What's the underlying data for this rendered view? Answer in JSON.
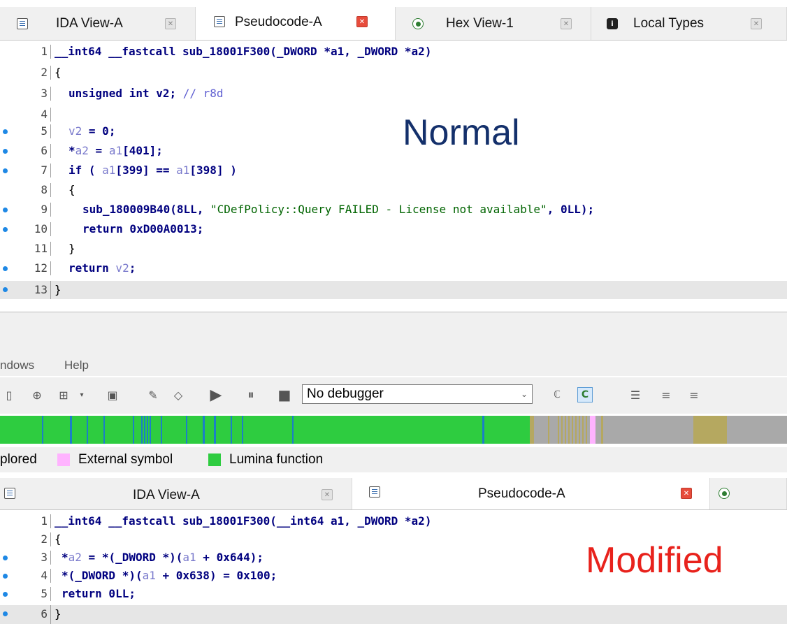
{
  "top_tabs": [
    {
      "label": "IDA View-A",
      "icon": "list-icon",
      "active": false
    },
    {
      "label": "Pseudocode-A",
      "icon": "list-icon",
      "active": true
    },
    {
      "label": "Hex View-1",
      "icon": "hex-icon",
      "active": false
    },
    {
      "label": "Local Types",
      "icon": "info-icon",
      "active": false
    }
  ],
  "normal_label": "Normal",
  "normal_code": {
    "line_numbers": [
      "1",
      "2",
      "3",
      "4",
      "5",
      "6",
      "7",
      "8",
      "9",
      "10",
      "11",
      "12",
      "13"
    ],
    "l1": {
      "t1": "__int64 __fastcall sub_18001F300(",
      "t2": "_DWORD *a1, _DWORD *a2)"
    },
    "l2": {
      "t1": "{"
    },
    "l3": {
      "kw": "unsigned int",
      "t1": " v2; ",
      "cm": "// r8d"
    },
    "l5": {
      "var": "v2",
      "op": " = ",
      "num": "0",
      "pun": ";"
    },
    "l6": {
      "t1": "*",
      "var1": "a2",
      "op": " = ",
      "var2": "a1",
      "t2": "[401];"
    },
    "l7": {
      "kw": "if",
      "t1": " ( ",
      "var1": "a1",
      "t2": "[399] == ",
      "var2": "a1",
      "t3": "[398] )"
    },
    "l8": {
      "t1": "{"
    },
    "l9": {
      "id": "sub_180009B40",
      "t1": "(8LL, ",
      "str": "\"CDefPolicy::Query FAILED - License not available\"",
      "t2": ", 0LL);"
    },
    "l10": {
      "kw": "return",
      "num": " 0xD00A0013",
      "pun": ";"
    },
    "l11": {
      "t1": "}"
    },
    "l12": {
      "kw": "return",
      "var": " v2",
      "pun": ";"
    },
    "l13": {
      "t1": "}"
    }
  },
  "menu": {
    "item1": "ndows",
    "item2": "Help"
  },
  "debugger_select": "No debugger",
  "legend": {
    "prefix": "plored",
    "external": "External symbol",
    "lumina": "Lumina function"
  },
  "legend_colors": {
    "external": "#ffb3ff",
    "lumina": "#2ecc40"
  },
  "bottom_tabs": [
    {
      "label": "IDA View-A",
      "icon": "list-icon",
      "active": false
    },
    {
      "label": "Pseudocode-A",
      "icon": "list-icon",
      "active": true
    }
  ],
  "modified_label": "Modified",
  "modified_code": {
    "line_numbers": [
      "1",
      "2",
      "3",
      "4",
      "5",
      "6"
    ],
    "l1": {
      "t1": "__int64 __fastcall sub_18001F300(",
      "t2": "__int64 a1, _DWORD *a2)"
    },
    "l2": {
      "t1": "{"
    },
    "l3": {
      "t1": "*",
      "var1": "a2",
      "op": " = ",
      "t2": "*(_DWORD *)(",
      "var2": "a1",
      "t3": " + ",
      "num": "0x644",
      "t4": ");"
    },
    "l4": {
      "t1": "*(_DWORD *)(",
      "var1": "a1",
      "t2": " + ",
      "num1": "0x638",
      "t3": ") = ",
      "num2": "0x100",
      "t4": ";"
    },
    "l5": {
      "kw": "return",
      "num": " 0LL",
      "pun": ";"
    },
    "l6": {
      "t1": "}"
    }
  }
}
